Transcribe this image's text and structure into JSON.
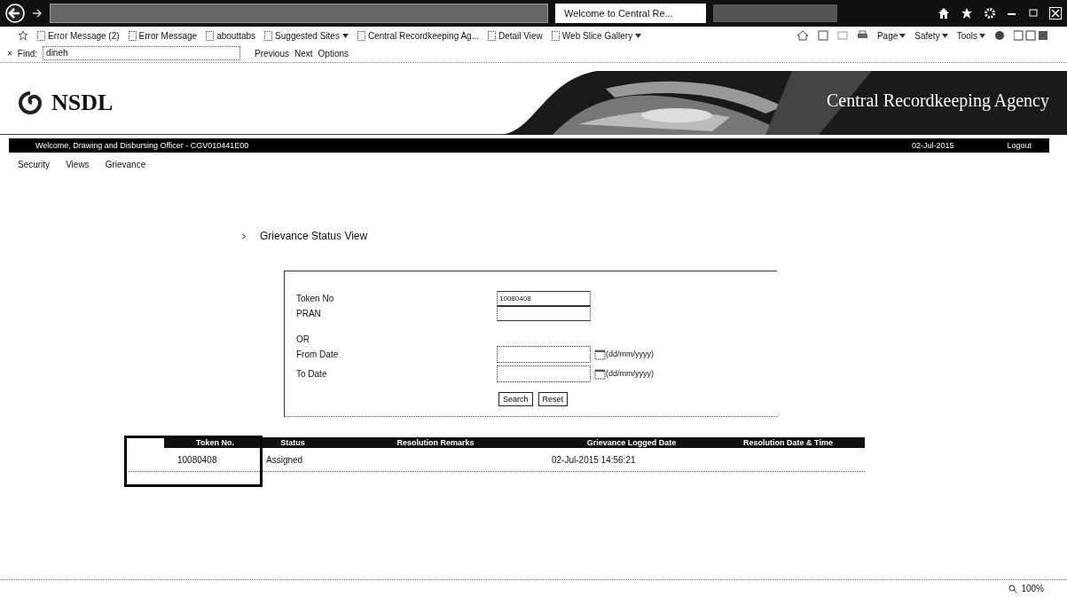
{
  "browser": {
    "tabs": [
      {
        "label": "Welcome to Central Re...",
        "selected": true
      }
    ],
    "favorites": [
      {
        "label": "Error Message (2)",
        "dropdown": false
      },
      {
        "label": "Error Message",
        "dropdown": false
      },
      {
        "label": "abouttabs",
        "dropdown": false
      },
      {
        "label": "Suggested Sites",
        "dropdown": true
      },
      {
        "label": "Central Recordkeeping Ag...",
        "dropdown": false
      },
      {
        "label": "Detail View",
        "dropdown": false
      },
      {
        "label": "Web Slice Gallery",
        "dropdown": true
      }
    ],
    "commands": [
      "Page",
      "Safety",
      "Tools"
    ],
    "find_bar": {
      "close": "×",
      "label": "Find:",
      "value": "dineh",
      "buttons": [
        "Previous",
        "Next",
        "Options"
      ]
    }
  },
  "header": {
    "logo": "NSDL",
    "agency": "Central Recordkeeping Agency"
  },
  "user_bar": {
    "welcome": "Welcome, Drawing and Disbursing Officer - CGV010441E00",
    "date": "02-Jul-2015",
    "logout": "Logout"
  },
  "menu": [
    "Security",
    "Views",
    "Grievance"
  ],
  "page_title": "Grievance Status View",
  "form": {
    "fields": [
      {
        "kind": "text",
        "label": "Token No",
        "value": "10080408"
      },
      {
        "kind": "text",
        "label": "PRAN"
      },
      {
        "kind": "separator",
        "label": "OR"
      },
      {
        "kind": "date",
        "label": "From Date",
        "format_hint": "(dd/mm/yyyy)"
      },
      {
        "kind": "date",
        "label": "To Date",
        "format_hint": "(dd/mm/yyyy)"
      }
    ],
    "buttons": [
      "Search",
      "Reset"
    ]
  },
  "table": {
    "columns": [
      "Token No.",
      "Status",
      "Resolution Remarks",
      "Grievance Logged Date",
      "Resolution Date & Time"
    ],
    "rows": [
      {
        "token_no": "10080408",
        "status": "Assigned",
        "logged_date": "02-Jul-2015 14:56:21"
      }
    ]
  },
  "status_bar": {
    "zoom": "100%"
  }
}
